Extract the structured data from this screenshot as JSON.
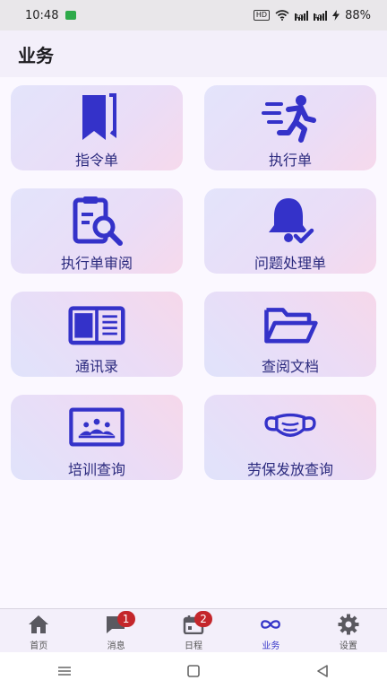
{
  "status_bar": {
    "time": "10:48",
    "battery": "88%",
    "network": "4G",
    "hd": "HD"
  },
  "app_bar": {
    "title": "业务"
  },
  "accent_color": "#3535c8",
  "badge_color": "#c4262b",
  "tiles": [
    {
      "label": "指令单",
      "icon": "bookmark-icon"
    },
    {
      "label": "执行单",
      "icon": "running-person-icon"
    },
    {
      "label": "执行单审阅",
      "icon": "clipboard-search-icon"
    },
    {
      "label": "问题处理单",
      "icon": "bell-check-icon"
    },
    {
      "label": "通讯录",
      "icon": "contacts-book-icon"
    },
    {
      "label": "查阅文档",
      "icon": "folder-open-icon"
    },
    {
      "label": "培训查询",
      "icon": "classroom-icon"
    },
    {
      "label": "劳保发放查询",
      "icon": "face-mask-icon"
    }
  ],
  "bottom_nav": {
    "active": "业务",
    "items": [
      {
        "label": "首页",
        "icon": "home-icon",
        "badge": ""
      },
      {
        "label": "消息",
        "icon": "message-icon",
        "badge": "1"
      },
      {
        "label": "日程",
        "icon": "calendar-icon",
        "badge": "2"
      },
      {
        "label": "业务",
        "icon": "infinity-icon",
        "badge": ""
      },
      {
        "label": "设置",
        "icon": "gear-icon",
        "badge": ""
      }
    ]
  }
}
